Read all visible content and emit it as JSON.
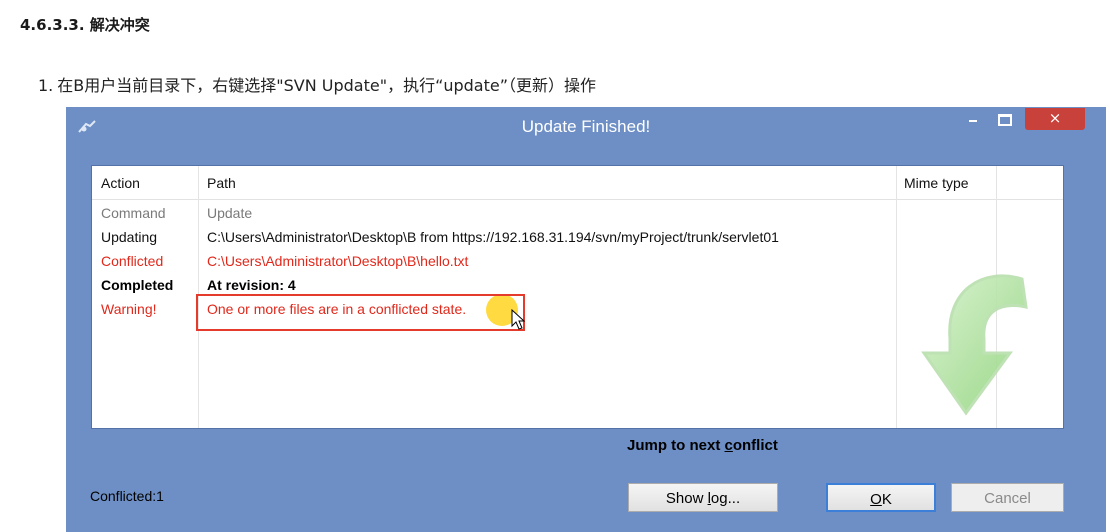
{
  "doc": {
    "heading": "4.6.3.3. 解决冲突",
    "step_number": "1.",
    "step_text": "在B用户当前目录下，右键选择\"SVN Update\"，执行“update”（更新）操作"
  },
  "dialog": {
    "title": "Update Finished!",
    "close_label": "×",
    "columns": {
      "action": "Action",
      "path": "Path",
      "mime": "Mime type"
    },
    "rows": [
      {
        "action": "Command",
        "path": "Update",
        "style": "gray"
      },
      {
        "action": "Updating",
        "path": "C:\\Users\\Administrator\\Desktop\\B from https://192.168.31.194/svn/myProject/trunk/servlet01",
        "style": "normal"
      },
      {
        "action": "Conflicted",
        "path": "C:\\Users\\Administrator\\Desktop\\B\\hello.txt",
        "style": "red"
      },
      {
        "action": "Completed",
        "path": "At revision: 4",
        "style": "bold"
      },
      {
        "action": "Warning!",
        "path": "One or more files are in a conflicted state.",
        "style": "red"
      }
    ],
    "jump_label_pre": "Jump to next ",
    "jump_label_key": "c",
    "jump_label_post": "onflict",
    "status": "Conflicted:1",
    "buttons": {
      "show_log_pre": "Show ",
      "show_log_key": "l",
      "show_log_post": "og...",
      "ok_key": "O",
      "ok_post": "K",
      "cancel": "Cancel"
    }
  },
  "colors": {
    "dialog_bg": "#6d8fc5",
    "close_button": "#c9413b",
    "conflict_red": "#e0281b",
    "annotation_box": "#e53b2c",
    "cursor_highlight": "#ffcd00",
    "arrow_green": "#9bd88a"
  },
  "icons": [
    "tortoisesvn-app-icon",
    "minimize-icon",
    "maximize-icon",
    "close-icon",
    "update-arrow-icon",
    "mouse-cursor-icon"
  ]
}
